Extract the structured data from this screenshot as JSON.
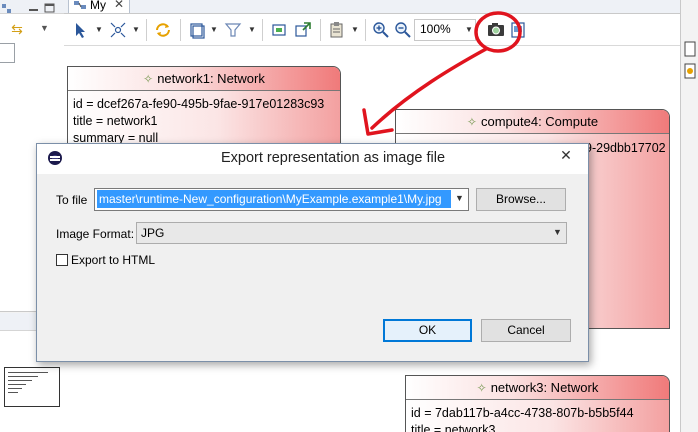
{
  "editor": {
    "tab_label": "My",
    "zoom": "100%"
  },
  "diagram": {
    "nodes": [
      {
        "title": "network1: Network",
        "attributes": [
          "id = dcef267a-fe90-495b-9fae-917e01283c93",
          "title = network1",
          "summary = null"
        ]
      },
      {
        "title": "compute4: Compute",
        "attributes": [
          "9-29dbb17702"
        ]
      },
      {
        "title": "network3: Network",
        "attributes": [
          "id = 7dab117b-a4cc-4738-807b-b5b5f44",
          "title = network3"
        ]
      }
    ]
  },
  "dialog": {
    "title": "Export representation as image file",
    "to_file_label": "To file",
    "file_path": "master\\runtime-New_configuration\\MyExample.example1\\My.jpg",
    "browse_label": "Browse...",
    "image_format_label": "Image Format:",
    "image_format_value": "JPG",
    "export_html_label": "Export to HTML",
    "export_html_checked": false,
    "ok_label": "OK",
    "cancel_label": "Cancel"
  },
  "colors": {
    "annotation": "#e0141e",
    "node_header_end": "#f07a7a",
    "selection": "#3399ff"
  },
  "icons": {
    "toolbar": [
      "select-icon",
      "layout-icon",
      "refresh-icon",
      "page-icon",
      "filter-icon",
      "snap-icon",
      "pin-icon",
      "clipboard-icon",
      "zoom-in-icon",
      "zoom-out-icon",
      "camera-icon",
      "export-icon"
    ]
  }
}
